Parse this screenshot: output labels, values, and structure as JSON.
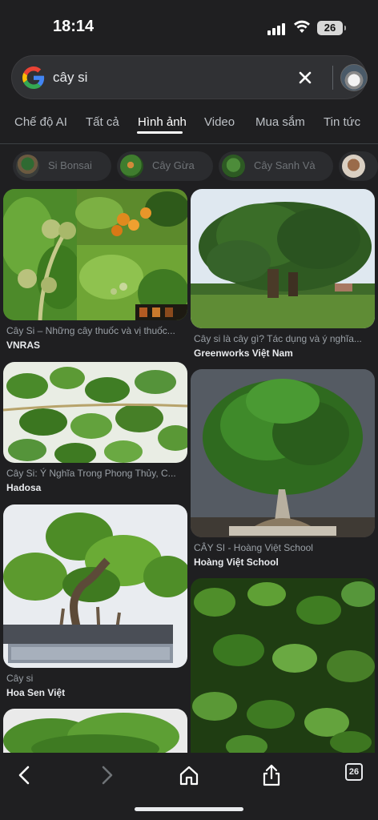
{
  "status_bar": {
    "time": "18:14",
    "battery": "26"
  },
  "search": {
    "query": "cây si"
  },
  "tabs": [
    {
      "label": "Chế độ AI"
    },
    {
      "label": "Tất cả"
    },
    {
      "label": "Hình ảnh",
      "active": true
    },
    {
      "label": "Video"
    },
    {
      "label": "Mua sắm"
    },
    {
      "label": "Tin tức"
    }
  ],
  "chips": [
    {
      "label": "Si Bonsai"
    },
    {
      "label": "Cây Gừa"
    },
    {
      "label": "Cây Sanh Và"
    },
    {
      "label": ""
    }
  ],
  "results": [
    {
      "title": "Cây Si – Những cây thuốc và vị thuốc...",
      "source": "VNRAS"
    },
    {
      "title": "Cây si là cây gì? Tác dụng và ý nghĩa...",
      "source": "Greenworks Việt Nam"
    },
    {
      "title": "Cây Si: Ý Nghĩa Trong Phong Thủy, C...",
      "source": "Hadosa"
    },
    {
      "title": "CÂY SI - Hoàng Việt School",
      "source": "Hoàng Việt School"
    },
    {
      "title": "Cây si",
      "source": "Hoa Sen Việt"
    }
  ],
  "toolbar": {
    "tab_count": "26"
  }
}
